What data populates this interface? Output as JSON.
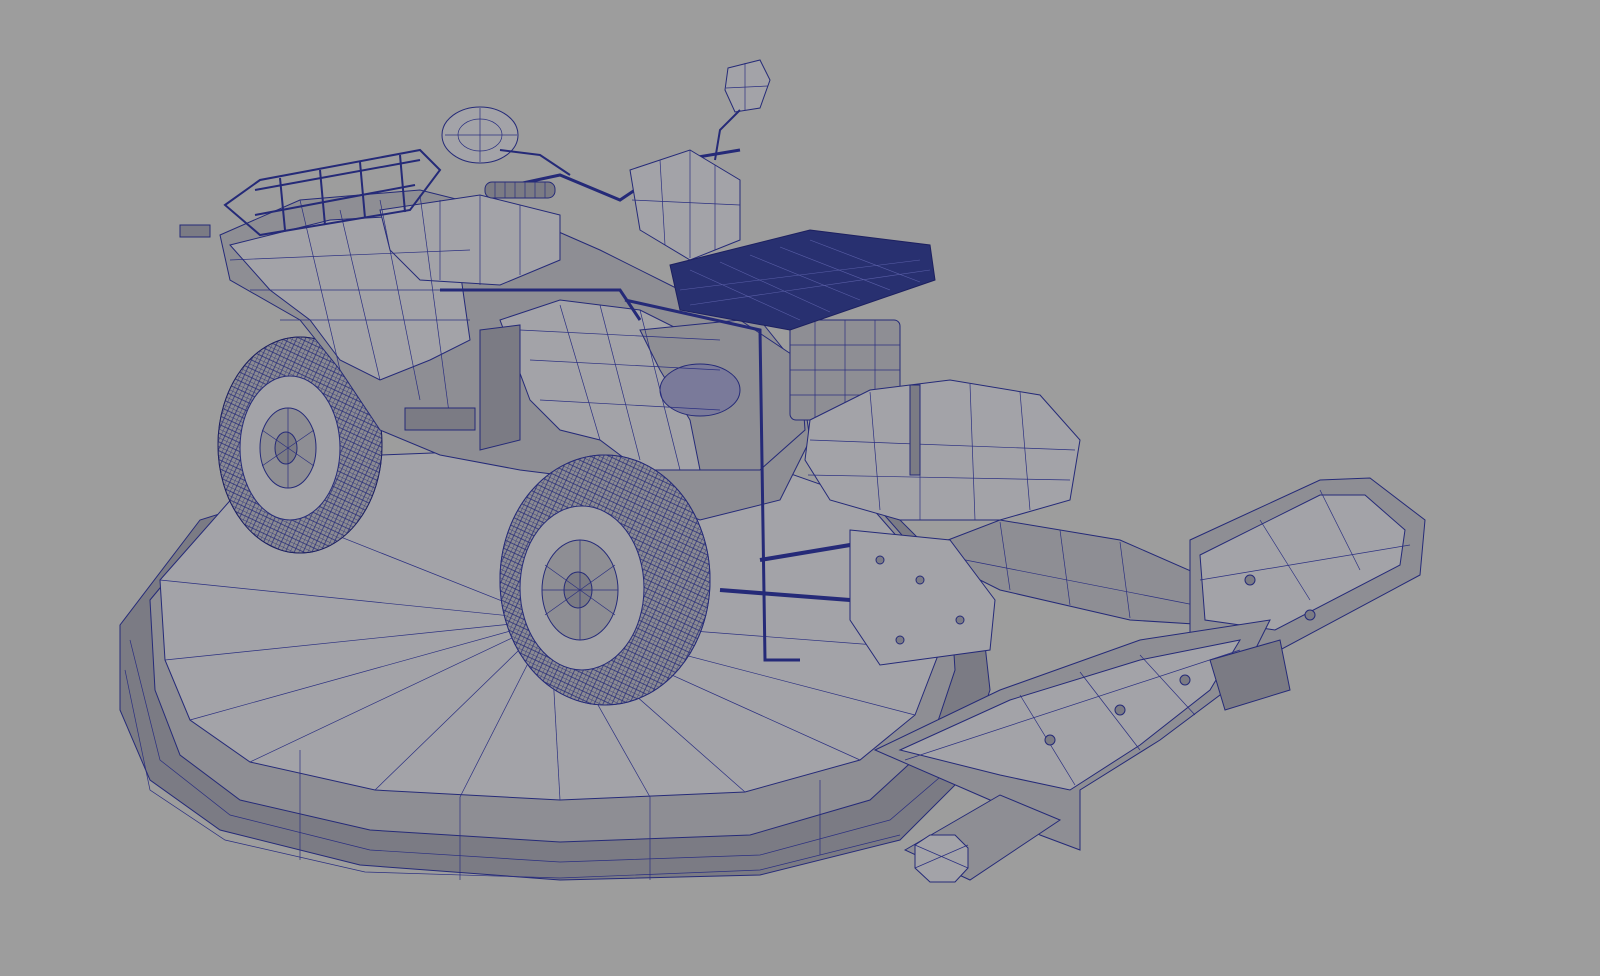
{
  "viewport": {
    "background_color": "#9d9d9d",
    "wire_color": "#252a78",
    "shading_mode": "wireframe-on-shaded"
  },
  "scene": {
    "objects": [
      {
        "name": "turntable-base",
        "icon": "cylinder-mesh"
      },
      {
        "name": "atv-body",
        "icon": "vehicle-mesh"
      },
      {
        "name": "front-wheel-right",
        "icon": "tire-mesh"
      },
      {
        "name": "rear-wheel-left",
        "icon": "tire-mesh"
      },
      {
        "name": "cargo-rack-rear",
        "icon": "rack-mesh"
      },
      {
        "name": "cargo-basket-front",
        "icon": "basket-mesh"
      },
      {
        "name": "snow-plow-blade",
        "icon": "plow-mesh"
      },
      {
        "name": "side-mirror-left",
        "icon": "mirror-mesh"
      },
      {
        "name": "side-mirror-right",
        "icon": "mirror-mesh"
      }
    ]
  }
}
